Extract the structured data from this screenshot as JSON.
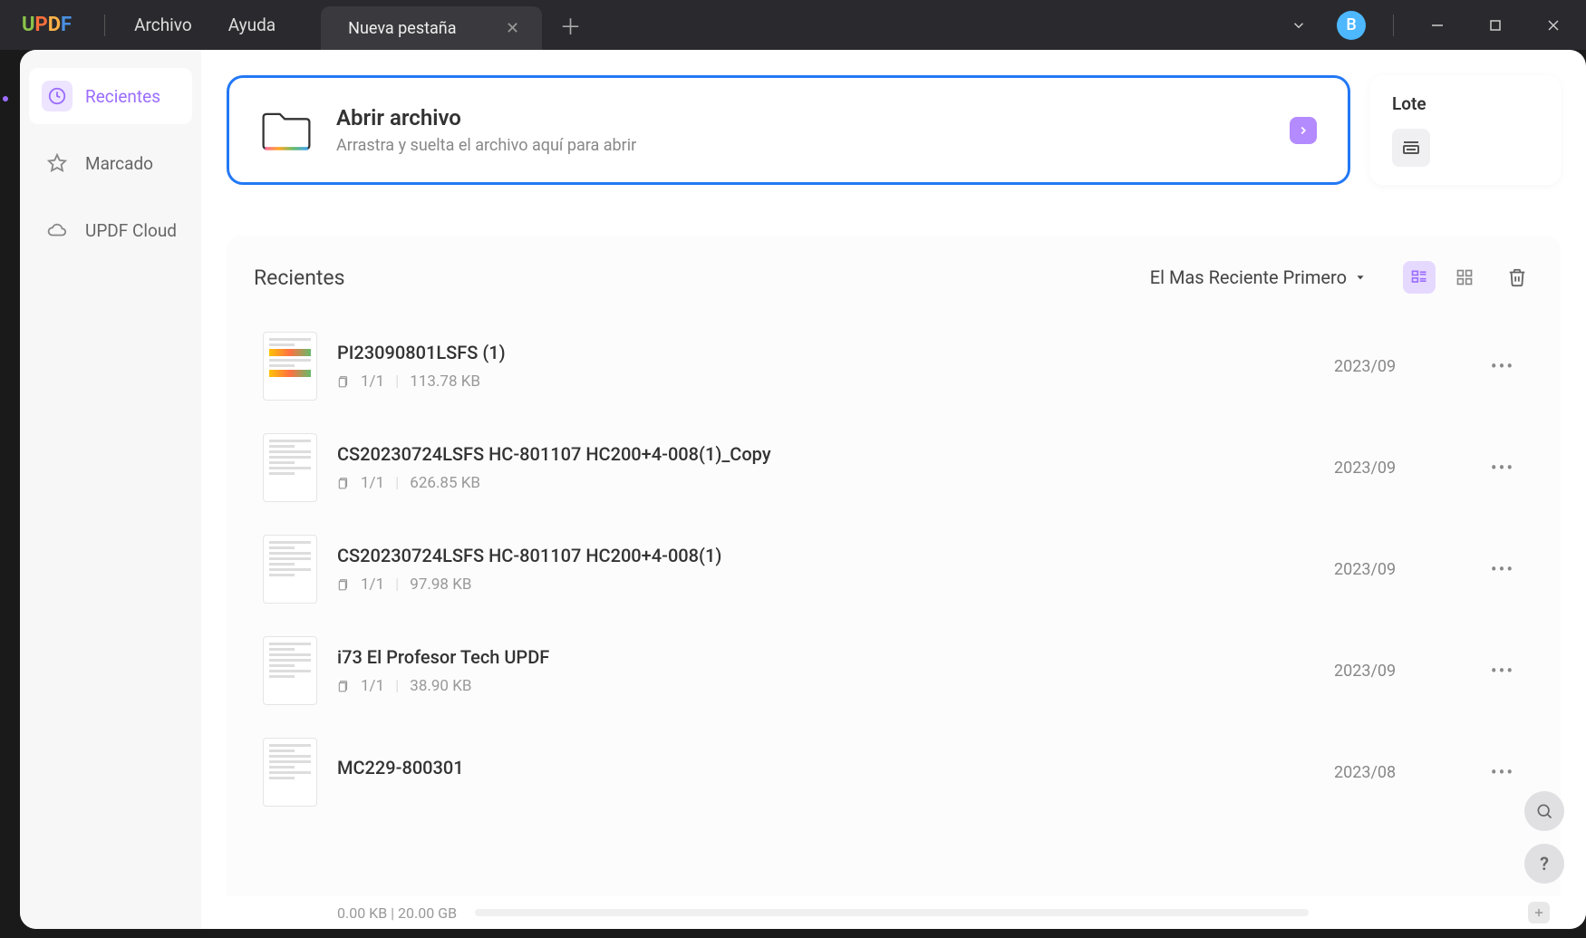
{
  "titlebar": {
    "logo_text": "UPDF",
    "menu": {
      "file": "Archivo",
      "help": "Ayuda"
    },
    "tab": {
      "title": "Nueva pestaña"
    },
    "avatar_initial": "B"
  },
  "sidebar": {
    "items": [
      {
        "label": "Recientes",
        "icon": "clock"
      },
      {
        "label": "Marcado",
        "icon": "star"
      },
      {
        "label": "UPDF Cloud",
        "icon": "cloud"
      }
    ]
  },
  "open_card": {
    "title": "Abrir archivo",
    "subtitle": "Arrastra y suelta el archivo aquí para abrir"
  },
  "batch": {
    "title": "Lote"
  },
  "recents": {
    "title": "Recientes",
    "sort_label": "El Mas Reciente Primero",
    "files": [
      {
        "name": "PI23090801LSFS (1)",
        "pages": "1/1",
        "size": "113.78 KB",
        "date": "2023/09",
        "thumb_style": "color"
      },
      {
        "name": "CS20230724LSFS     HC-801107   HC200+4-008(1)_Copy",
        "pages": "1/1",
        "size": "626.85 KB",
        "date": "2023/09",
        "thumb_style": "doc"
      },
      {
        "name": "CS20230724LSFS     HC-801107   HC200+4-008(1)",
        "pages": "1/1",
        "size": "97.98 KB",
        "date": "2023/09",
        "thumb_style": "doc"
      },
      {
        "name": "i73 El Profesor Tech UPDF",
        "pages": "1/1",
        "size": "38.90 KB",
        "date": "2023/09",
        "thumb_style": "doc"
      },
      {
        "name": "MC229-800301",
        "pages": "",
        "size": "",
        "date": "2023/08",
        "thumb_style": "doc"
      }
    ]
  },
  "storage": {
    "label": "0.00 KB | 20.00 GB"
  }
}
